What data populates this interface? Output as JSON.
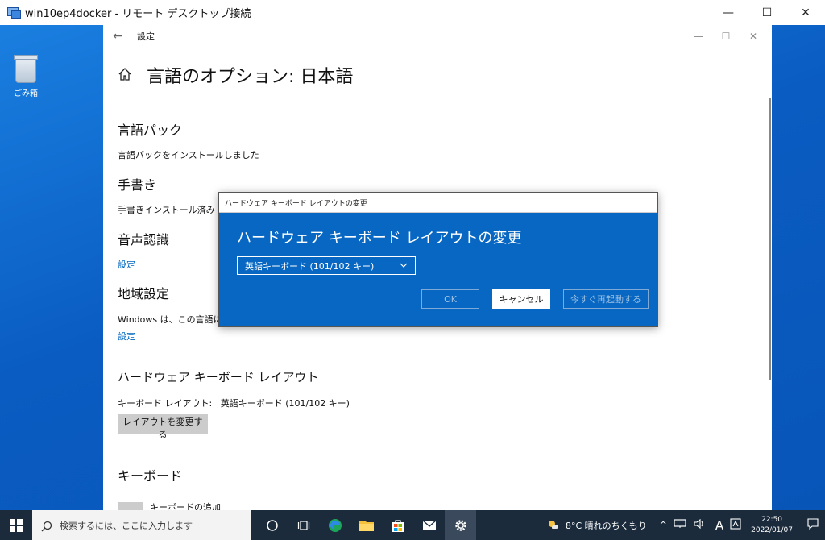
{
  "rdp_window": {
    "title": "win10ep4docker - リモート デスクトップ接続",
    "controls": {
      "minimize": "—",
      "maximize": "☐",
      "close": "✕"
    }
  },
  "desktop": {
    "recycle_bin_label": "ごみ箱"
  },
  "settings": {
    "app_title": "設定",
    "back_glyph": "←",
    "page_title": "言語のオプション: 日本語",
    "sections": {
      "language_pack": {
        "title": "言語パック",
        "text": "言語パックをインストールしました"
      },
      "handwriting": {
        "title": "手書き",
        "text": "手書きインストール済み"
      },
      "speech": {
        "title": "音声認識",
        "link": "設定"
      },
      "regional": {
        "title": "地域設定",
        "text": "Windows は、この言語に基",
        "link": "設定"
      },
      "hardware_keyboard": {
        "title": "ハードウェア キーボード レイアウト",
        "layout_label": "キーボード レイアウト:",
        "layout_value": "英語キーボード (101/102 キー)",
        "change_button": "レイアウトを変更する"
      },
      "keyboard": {
        "title": "キーボード",
        "add_label": "キーボードの追加"
      }
    }
  },
  "dialog": {
    "title": "ハードウェア キーボード レイアウトの変更",
    "heading": "ハードウェア キーボード レイアウトの変更",
    "select_value": "英語キーボード (101/102 キー)",
    "ok_label": "OK",
    "cancel_label": "キャンセル",
    "restart_label": "今すぐ再起動する"
  },
  "taskbar": {
    "search_placeholder": "検索するには、ここに入力します",
    "weather": "8°C  晴れのちくもり",
    "ime_indicator": "A",
    "time": "22:50",
    "date": "2022/01/07"
  },
  "colors": {
    "dialog_blue": "#0767c2",
    "link_blue": "#0067c0",
    "taskbar": "#1b2b3c"
  }
}
